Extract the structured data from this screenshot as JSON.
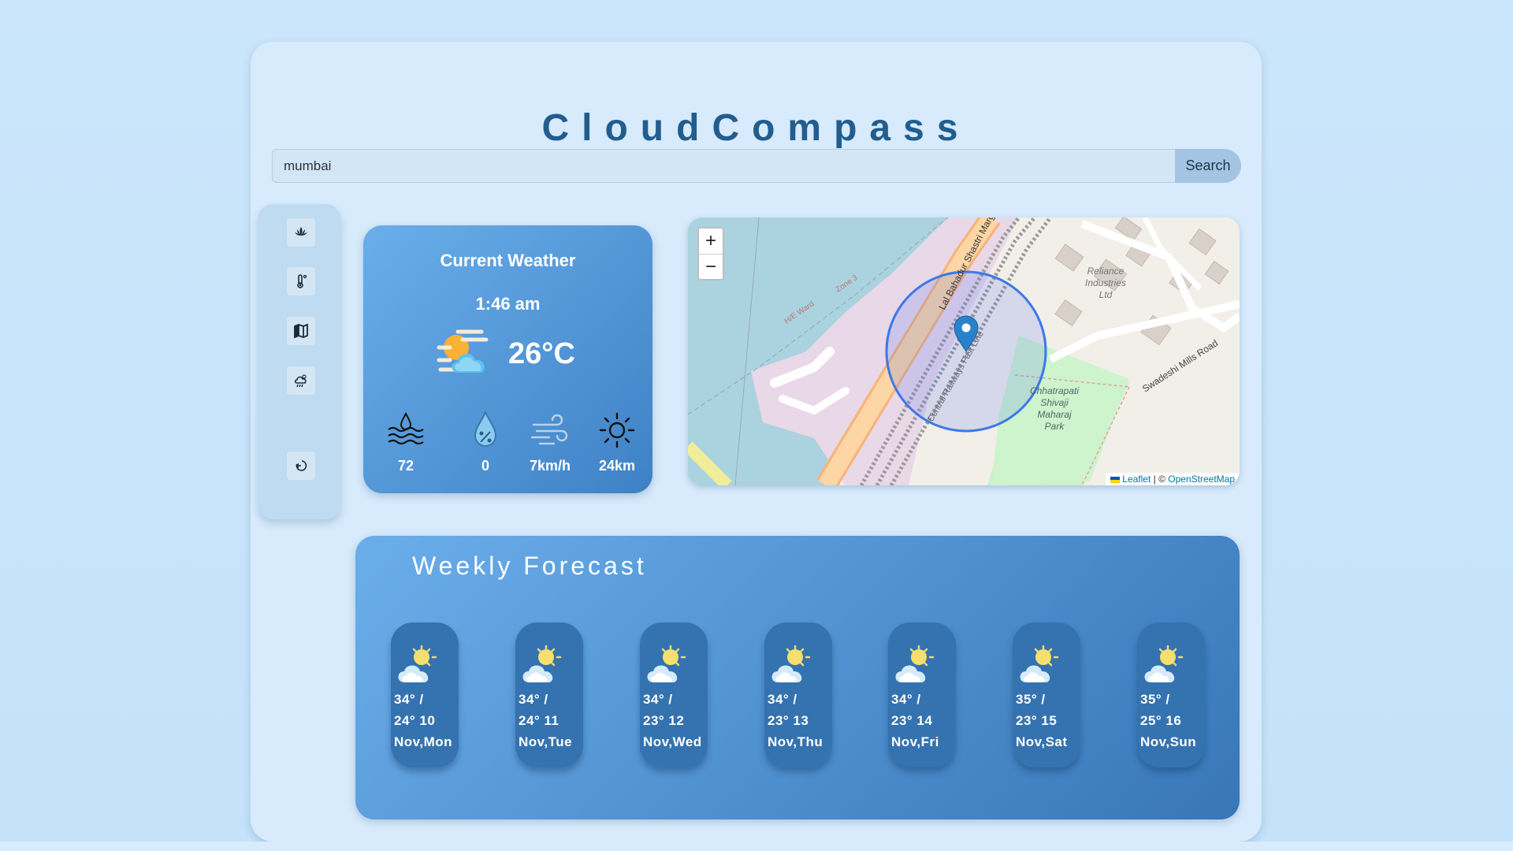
{
  "app": {
    "title": "CloudCompass"
  },
  "search": {
    "value": "mumbai",
    "button_label": "Search"
  },
  "sidebar": {
    "items": [
      {
        "icon": "lotus-icon"
      },
      {
        "icon": "thermometer-icon"
      },
      {
        "icon": "map-icon"
      },
      {
        "icon": "storm-cloud-icon"
      },
      {
        "icon": "logout-icon"
      }
    ]
  },
  "current_weather": {
    "title": "Current Weather",
    "time": "1:46 am",
    "temperature": "26°C",
    "condition_icon": "partly-cloudy-icon",
    "stats": [
      {
        "icon": "humidity-icon",
        "value": "72"
      },
      {
        "icon": "precipitation-icon",
        "value": "0"
      },
      {
        "icon": "wind-icon",
        "value": "7km/h"
      },
      {
        "icon": "visibility-sun-icon",
        "value": "24km"
      }
    ]
  },
  "map": {
    "zoom_in": "+",
    "zoom_out": "−",
    "labels": {
      "road1": "Lal Bahadur Shastri Marg",
      "road2": "Central Railways Fast Line",
      "road3": "Swadeshi Mills Road",
      "ward": "H/E Ward",
      "zone": "Zone 3",
      "place1": "Reliance Industries Ltd",
      "park": "Chhatrapati Shivaji Maharaj Park"
    },
    "attribution": {
      "leaflet": "Leaflet",
      "sep": " | © ",
      "osm": "OpenStreetMap"
    }
  },
  "forecast": {
    "title": "Weekly Forecast",
    "days": [
      {
        "temps": "34° /",
        "low_date": "24° 10",
        "day": "Nov,Mon"
      },
      {
        "temps": "34° /",
        "low_date": "24° 11",
        "day": "Nov,Tue"
      },
      {
        "temps": "34° /",
        "low_date": "23° 12",
        "day": "Nov,Wed"
      },
      {
        "temps": "34° /",
        "low_date": "23° 13",
        "day": "Nov,Thu"
      },
      {
        "temps": "34° /",
        "low_date": "23° 14",
        "day": "Nov,Fri"
      },
      {
        "temps": "35° /",
        "low_date": "23° 15",
        "day": "Nov,Sat"
      },
      {
        "temps": "35° /",
        "low_date": "25° 16",
        "day": "Nov,Sun"
      }
    ]
  }
}
